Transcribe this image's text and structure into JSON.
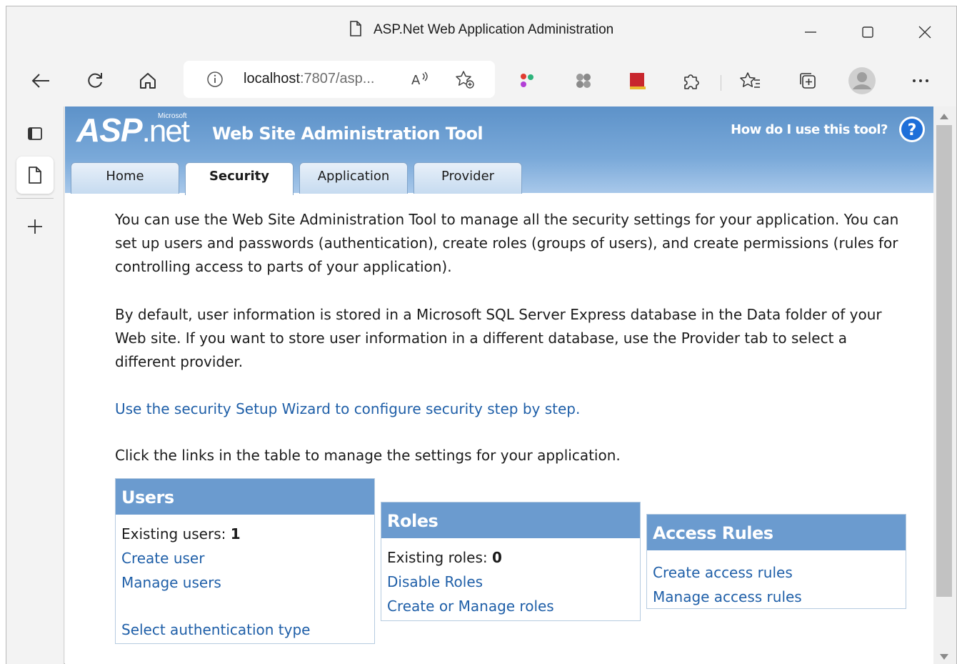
{
  "browser": {
    "window_title": "ASP.Net Web Application Administration",
    "address": "localhost:7807/asp...",
    "address_host": "localhost",
    "address_rest": ":7807/asp..."
  },
  "header": {
    "logo_asp": "ASP",
    "logo_net": ".net",
    "logo_ms": "Microsoft",
    "title": "Web Site Administration Tool",
    "help_link": "How do I use this tool?"
  },
  "tabs": [
    {
      "label": "Home"
    },
    {
      "label": "Security"
    },
    {
      "label": "Application"
    },
    {
      "label": "Provider"
    }
  ],
  "content": {
    "intro": "You can use the Web Site Administration Tool to manage all the security settings for your application. You can set up users and passwords (authentication), create roles (groups of users), and create permissions (rules for controlling access to parts of your application).",
    "default_info": "By default, user information is stored in a Microsoft SQL Server Express database in the Data folder of your Web site. If you want to store user information in a different database, use the Provider tab to select a different provider.",
    "wizard_link": "Use the security Setup Wizard to configure security step by step.",
    "table_intro": "Click the links in the table to manage the settings for your application."
  },
  "panels": {
    "users": {
      "title": "Users",
      "existing_label": "Existing users: ",
      "existing_count": "1",
      "create": "Create user",
      "manage": "Manage users",
      "auth_type": "Select authentication type"
    },
    "roles": {
      "title": "Roles",
      "existing_label": "Existing roles: ",
      "existing_count": "0",
      "disable": "Disable Roles",
      "manage": "Create or Manage roles"
    },
    "access": {
      "title": "Access Rules",
      "create": "Create access rules",
      "manage": "Manage access rules"
    }
  },
  "colors": {
    "header_blue": "#6b9bcf",
    "link_blue": "#1f5fa8",
    "help_icon": "#1e6fd9"
  }
}
